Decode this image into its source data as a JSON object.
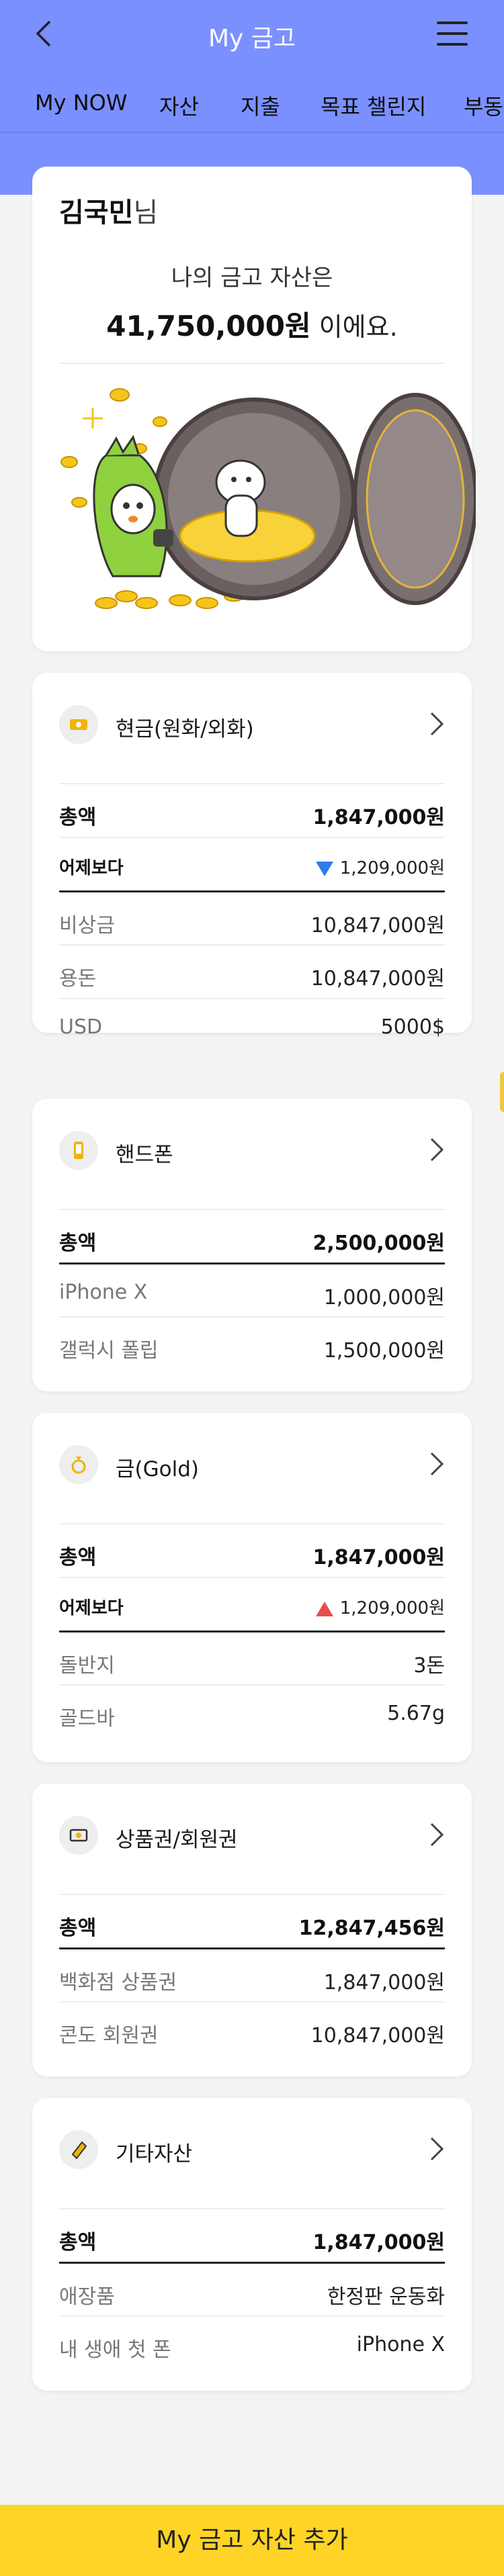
{
  "header": {
    "title": "My 금고"
  },
  "tabs": [
    "My NOW",
    "자산",
    "지출",
    "목표 챌린지",
    "부동산"
  ],
  "summary": {
    "name": "김국민",
    "name_suffix": "님",
    "line1": "나의 금고 자산은",
    "amount": "41,750,000원",
    "amount_suffix": " 이에요."
  },
  "sections": [
    {
      "title": "현금(원화/외화)",
      "icon": "cash-icon",
      "total_label": "총액",
      "total_value": "1,847,000원",
      "compare_label": "어제보다",
      "compare_value": "1,209,000원",
      "compare_dir": "down",
      "items": [
        {
          "label": "비상금",
          "value": "10,847,000원"
        },
        {
          "label": "용돈",
          "value": "10,847,000원"
        },
        {
          "label": "USD",
          "value": "5000$"
        }
      ]
    },
    {
      "title": "핸드폰",
      "icon": "phone-icon",
      "total_label": "총액",
      "total_value": "2,500,000원",
      "items": [
        {
          "label": "iPhone X",
          "value": "1,000,000원"
        },
        {
          "label": "갤럭시 폴립",
          "value": "1,500,000원"
        }
      ]
    },
    {
      "title": "금(Gold)",
      "icon": "ring-icon",
      "total_label": "총액",
      "total_value": "1,847,000원",
      "compare_label": "어제보다",
      "compare_value": "1,209,000원",
      "compare_dir": "up",
      "items": [
        {
          "label": "돌반지",
          "value": "3돈"
        },
        {
          "label": "골드바",
          "value": "5.67g"
        }
      ]
    },
    {
      "title": "상품권/회원권",
      "icon": "voucher-icon",
      "total_label": "총액",
      "total_value": "12,847,456원",
      "items": [
        {
          "label": "백화점 상품권",
          "value": "1,847,000원"
        },
        {
          "label": "콘도 회원권",
          "value": "10,847,000원"
        }
      ]
    },
    {
      "title": "기타자산",
      "icon": "ticket-icon",
      "total_label": "총액",
      "total_value": "1,847,000원",
      "items": [
        {
          "label": "애장품",
          "value": "한정판 운동화"
        },
        {
          "label": "내 생애 첫 폰",
          "value": "iPhone X"
        }
      ]
    }
  ],
  "bottom_button": "My 금고 자산 추가",
  "colors": {
    "header_bg": "#7b90ff",
    "cta_bg": "#ffd427",
    "down": "#2f7be9",
    "up": "#ea4d4d"
  }
}
